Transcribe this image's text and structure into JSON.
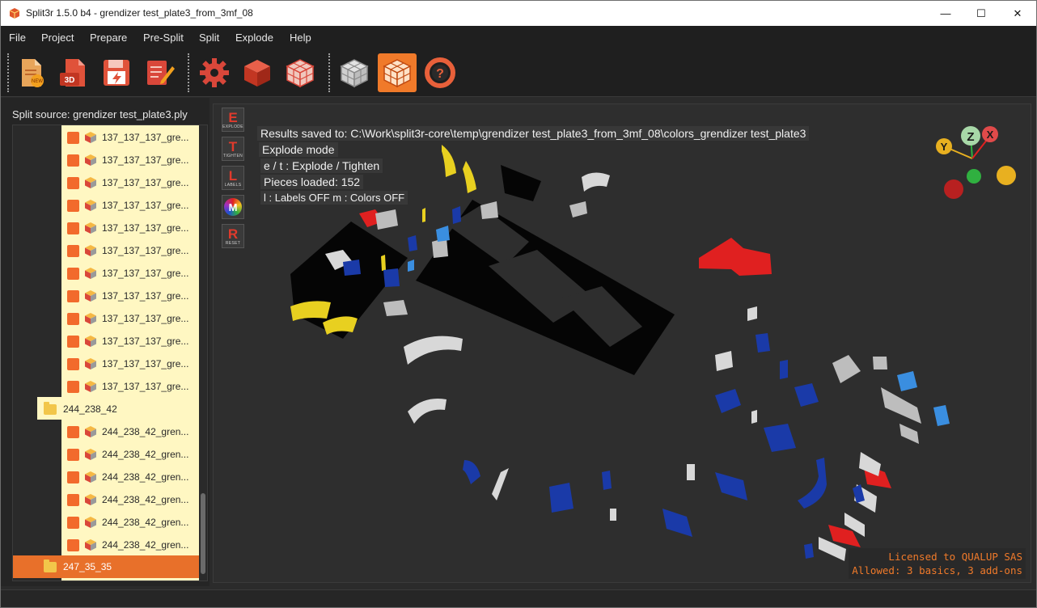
{
  "window": {
    "title": "Split3r 1.5.0 b4 - grendizer test_plate3_from_3mf_08",
    "controls": {
      "minimize": "—",
      "maximize": "☐",
      "close": "✕"
    }
  },
  "menu": [
    "File",
    "Project",
    "Prepare",
    "Pre-Split",
    "Split",
    "Explode",
    "Help"
  ],
  "toolbar": {
    "buttons": [
      {
        "name": "new-project",
        "badge": "NEW"
      },
      {
        "name": "open-3d",
        "badge": "3D"
      },
      {
        "name": "save-project",
        "badge": ""
      },
      {
        "name": "edit-notes",
        "badge": ""
      },
      {
        "name": "settings",
        "badge": ""
      },
      {
        "name": "solid-cube",
        "badge": ""
      },
      {
        "name": "split-cube",
        "badge": ""
      },
      {
        "name": "split-grey-cube",
        "badge": ""
      },
      {
        "name": "explode-cube",
        "badge": ""
      },
      {
        "name": "help",
        "badge": ""
      }
    ],
    "active": "explode-cube"
  },
  "left_panel": {
    "split_source_label": "Split source: grendizer test_plate3.ply",
    "tree": {
      "group_137_items": [
        "137_137_137_gre...",
        "137_137_137_gre...",
        "137_137_137_gre...",
        "137_137_137_gre...",
        "137_137_137_gre...",
        "137_137_137_gre...",
        "137_137_137_gre...",
        "137_137_137_gre...",
        "137_137_137_gre...",
        "137_137_137_gre...",
        "137_137_137_gre...",
        "137_137_137_gre..."
      ],
      "folder_244": "244_238_42",
      "group_244_items": [
        "244_238_42_gren...",
        "244_238_42_gren...",
        "244_238_42_gren...",
        "244_238_42_gren...",
        "244_238_42_gren...",
        "244_238_42_gren..."
      ],
      "folder_247": "247_35_35"
    }
  },
  "viewport": {
    "side_buttons": [
      {
        "letter": "E",
        "caption": "EXPLODE"
      },
      {
        "letter": "T",
        "caption": "TIGHTEN"
      },
      {
        "letter": "L",
        "caption": "LABELS"
      },
      {
        "letter": "M",
        "caption": ""
      },
      {
        "letter": "R",
        "caption": "RESET"
      }
    ],
    "info": {
      "results": "Results saved to: C:\\Work\\split3r-core\\temp\\grendizer test_plate3_from_3mf_08\\colors_grendizer test_plate3",
      "mode": "Explode mode",
      "keys": "e / t : Explode / Tighten",
      "pieces": "Pieces loaded: 152",
      "toggles": "l : Labels OFF    m : Colors OFF"
    },
    "axes": {
      "y": "Y",
      "z": "Z",
      "x": "X"
    },
    "license_line1": "Licensed to QUALUP SAS",
    "license_line2": "Allowed: 3 basics, 3 add-ons"
  },
  "colors": {
    "accent": "#f07a2a",
    "tree_highlight": "#fff7c2",
    "piece_red": "#e02020",
    "piece_blue": "#1a3aa8",
    "piece_yellow": "#e8d020",
    "piece_grey": "#d8d8d8"
  }
}
